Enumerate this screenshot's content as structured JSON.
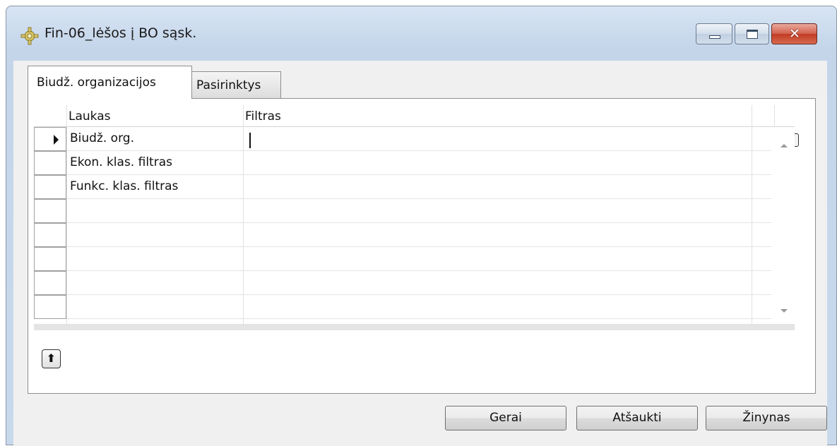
{
  "window": {
    "title": "Fin-06_lėšos į BO sąsk.",
    "icon": "gear-icon",
    "controls": {
      "minimize": "minimize-icon",
      "maximize": "maximize-icon",
      "close": "✕"
    }
  },
  "tabs": [
    {
      "label": "Biudž. organizacijos",
      "active": true
    },
    {
      "label": "Pasirinktys",
      "active": false
    }
  ],
  "grid": {
    "columns": [
      "Laukas",
      "Filtras"
    ],
    "rows": [
      {
        "field": "Biudž. org.",
        "filter": "",
        "current": true
      },
      {
        "field": "Ekon. klas. filtras",
        "filter": ""
      },
      {
        "field": "Funkc. klas. filtras",
        "filter": ""
      },
      {
        "field": "",
        "filter": ""
      },
      {
        "field": "",
        "filter": ""
      },
      {
        "field": "",
        "filter": ""
      },
      {
        "field": "",
        "filter": ""
      },
      {
        "field": "",
        "filter": ""
      }
    ]
  },
  "lookup_button_glyph": "⬆",
  "bottom_buttons": {
    "ok": "Gerai",
    "cancel": "Atšaukti",
    "help": "Žinynas"
  }
}
